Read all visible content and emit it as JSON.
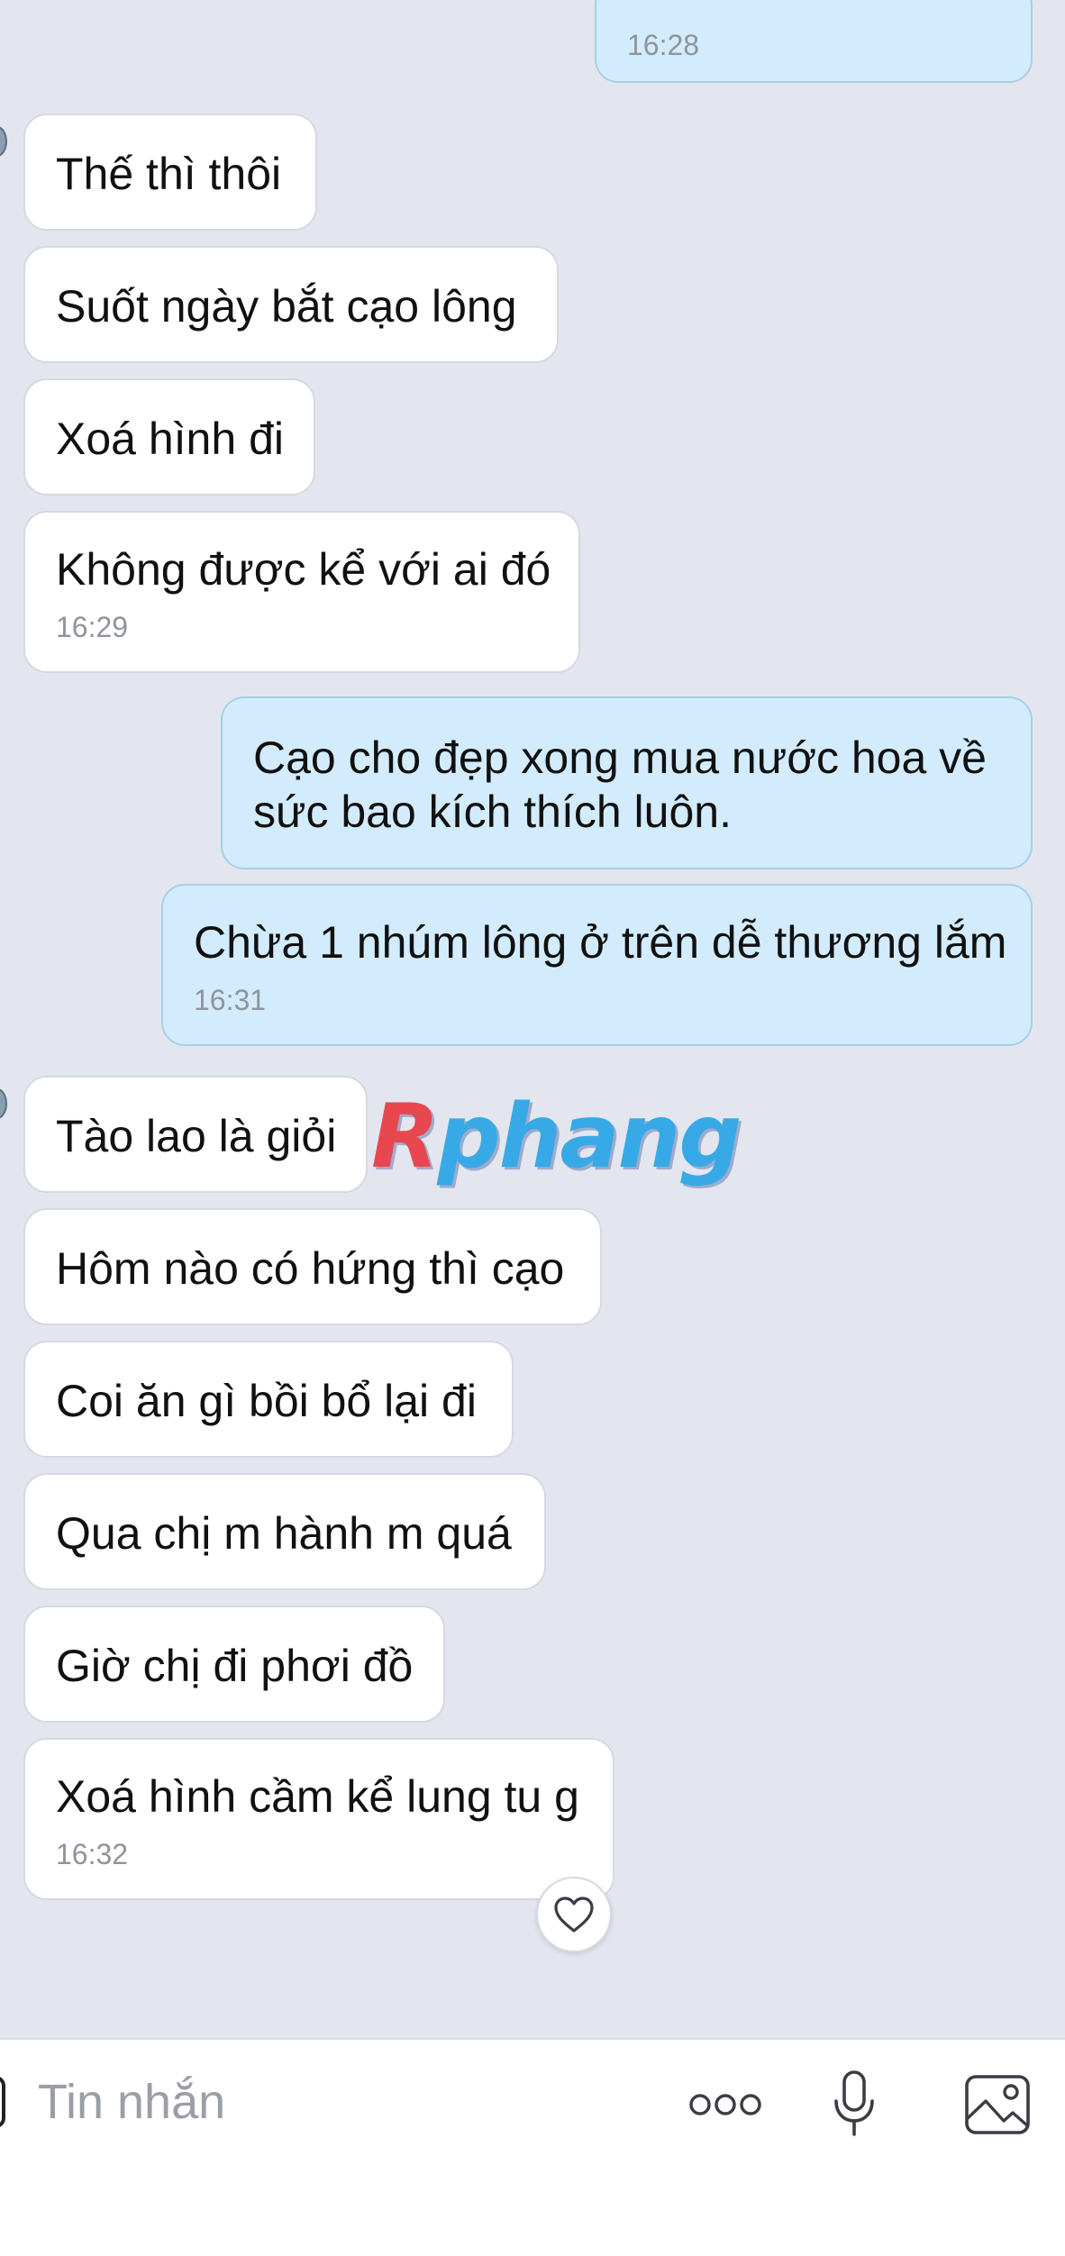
{
  "conversation": {
    "messages": [
      {
        "id": "m0",
        "dir": "out",
        "lines": [],
        "time": "16:28"
      },
      {
        "id": "m1",
        "dir": "in",
        "lines": [
          "Thế thì thôi"
        ],
        "time": ""
      },
      {
        "id": "m2",
        "dir": "in",
        "lines": [
          "Suốt ngày bắt cạo lông"
        ],
        "time": ""
      },
      {
        "id": "m3",
        "dir": "in",
        "lines": [
          "Xoá hình đi"
        ],
        "time": ""
      },
      {
        "id": "m4",
        "dir": "in",
        "lines": [
          "Không được kể với ai đó"
        ],
        "time": "16:29"
      },
      {
        "id": "m5",
        "dir": "out",
        "lines": [
          "Cạo cho đẹp xong mua nước hoa về",
          "sức bao kích thích luôn."
        ],
        "time": ""
      },
      {
        "id": "m6",
        "dir": "out",
        "lines": [
          "Chừa 1 nhúm lông ở trên dễ thương lắm"
        ],
        "time": "16:31"
      },
      {
        "id": "m7",
        "dir": "in",
        "lines": [
          "Tào lao là giỏi"
        ],
        "time": ""
      },
      {
        "id": "m8",
        "dir": "in",
        "lines": [
          "Hôm nào có hứng thì cạo"
        ],
        "time": ""
      },
      {
        "id": "m9",
        "dir": "in",
        "lines": [
          "Coi ăn gì bồi bổ lại đi"
        ],
        "time": ""
      },
      {
        "id": "m10",
        "dir": "in",
        "lines": [
          "Qua chị m hành m quá"
        ],
        "time": ""
      },
      {
        "id": "m11",
        "dir": "in",
        "lines": [
          "Giờ chị đi phơi đồ"
        ],
        "time": ""
      },
      {
        "id": "m12",
        "dir": "in",
        "lines": [
          "Xoá hình cầm kể lung tu g"
        ],
        "time": "16:32"
      }
    ]
  },
  "watermark": {
    "first": "R",
    "rest": "phang"
  },
  "reaction": {
    "icon": "heart-icon"
  },
  "input_bar": {
    "placeholder": "Tin nhắn",
    "icons": [
      "more-options-icon",
      "microphone-icon",
      "image-icon"
    ]
  },
  "colors": {
    "background": "#e3e6ef",
    "incoming_bubble": "#ffffff",
    "outgoing_bubble": "#d3ecfd",
    "timestamp": "#8f949c",
    "watermark_r": "#e8474f",
    "watermark_rest": "#37a9e6"
  }
}
